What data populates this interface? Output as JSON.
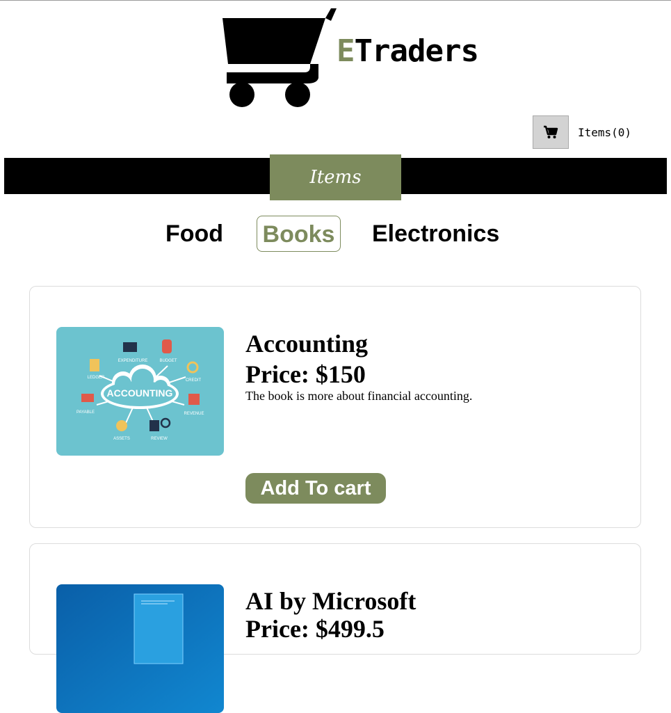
{
  "brand": {
    "first_letter": "E",
    "rest": "Traders"
  },
  "cart": {
    "icon": "shopping-cart-icon",
    "items_label": "Items(0)"
  },
  "section_tab": "Items",
  "categories": [
    {
      "label": "Food",
      "active": false
    },
    {
      "label": "Books",
      "active": true
    },
    {
      "label": "Electronics",
      "active": false
    }
  ],
  "products": [
    {
      "title": "Accounting",
      "price": "Price: $150",
      "description": "The book is more about financial accounting.",
      "button": "Add To cart",
      "image": {
        "center_label": "ACCOUNTING",
        "labels": [
          "EXPENDITURE",
          "BUDGET",
          "LEDGER",
          "CREDIT",
          "PAYABLE",
          "REVENUE",
          "ASSETS",
          "REVIEW"
        ]
      }
    },
    {
      "title": "AI by Microsoft",
      "price": "Price: $499.5"
    }
  ],
  "colors": {
    "accent": "#7d8b5d",
    "band": "#000000",
    "cart_button": "#d3d3d3"
  }
}
